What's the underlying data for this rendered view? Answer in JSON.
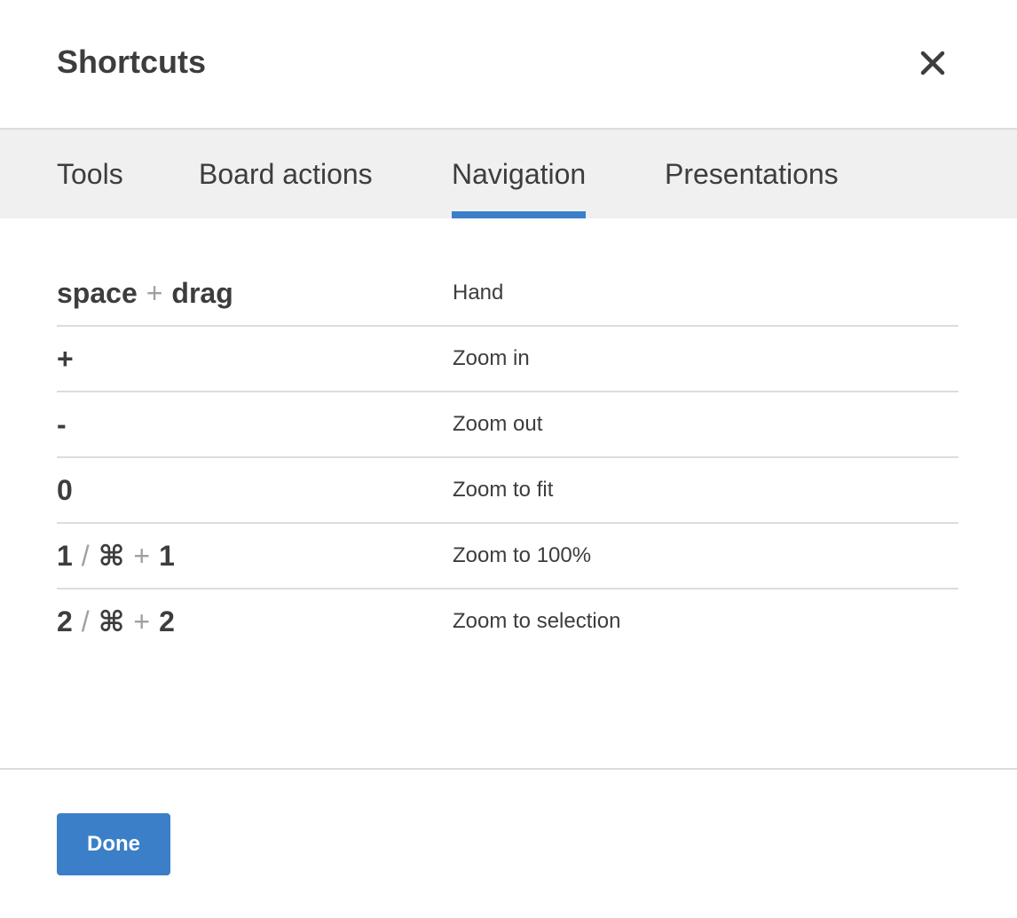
{
  "dialog": {
    "title": "Shortcuts",
    "close_icon": "close-icon"
  },
  "tabs": [
    {
      "label": "Tools",
      "active": false
    },
    {
      "label": "Board actions",
      "active": false
    },
    {
      "label": "Navigation",
      "active": true
    },
    {
      "label": "Presentations",
      "active": false
    }
  ],
  "shortcuts": [
    {
      "keys": [
        "space",
        "drag"
      ],
      "separators": [
        "+"
      ],
      "description": "Hand"
    },
    {
      "keys": [
        "+"
      ],
      "separators": [],
      "description": "Zoom in"
    },
    {
      "keys": [
        "-"
      ],
      "separators": [],
      "description": "Zoom out"
    },
    {
      "keys": [
        "0"
      ],
      "separators": [],
      "description": "Zoom to fit"
    },
    {
      "keys": [
        "1",
        "⌘",
        "1"
      ],
      "separators": [
        "/",
        "+"
      ],
      "description": "Zoom to 100%"
    },
    {
      "keys": [
        "2",
        "⌘",
        "2"
      ],
      "separators": [
        "/",
        "+"
      ],
      "description": "Zoom to selection"
    }
  ],
  "footer": {
    "done_label": "Done"
  },
  "colors": {
    "accent": "#3a7fc8",
    "tabbar_bg": "#f0f0f0",
    "text": "#3d3d3d",
    "separator": "#a0a0a0"
  }
}
